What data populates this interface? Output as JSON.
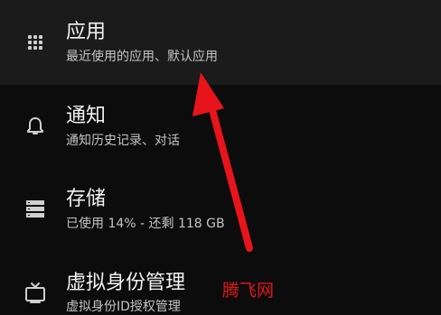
{
  "colors": {
    "background": "#0c0c0c",
    "highlight_row": "#1b1b1b",
    "title_text": "#f2f2f2",
    "subtitle_text": "#c4c4c4",
    "annotation_red": "#e8141b"
  },
  "settings": {
    "items": [
      {
        "icon": "apps-grid-icon",
        "title": "应用",
        "subtitle": "最近使用的应用、默认应用"
      },
      {
        "icon": "bell-icon",
        "title": "通知",
        "subtitle": "通知历史记录、对话"
      },
      {
        "icon": "storage-icon",
        "title": "存储",
        "subtitle": "已使用 14% - 还剩 118 GB"
      },
      {
        "icon": "tv-icon",
        "title": "虚拟身份管理",
        "subtitle": "虚拟身份ID授权管理"
      }
    ]
  },
  "watermark": {
    "text": "腾飞网"
  }
}
